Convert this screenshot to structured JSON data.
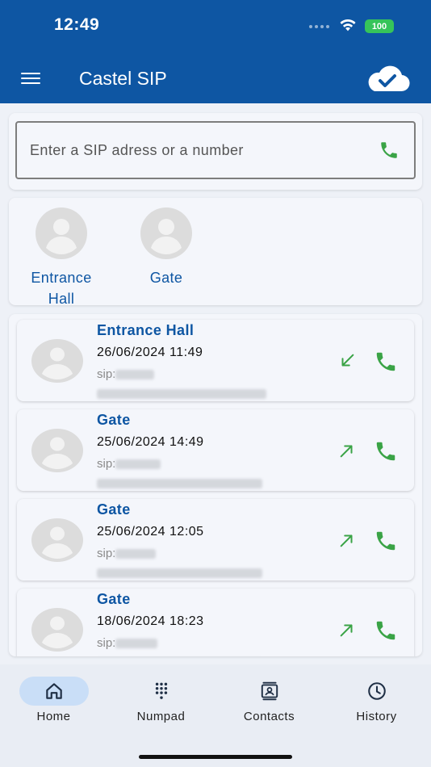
{
  "status_bar": {
    "time": "12:49",
    "battery": "100"
  },
  "app_bar": {
    "title": "Castel SIP",
    "menu_icon": "menu-icon",
    "status_icon": "cloud-check-icon"
  },
  "search": {
    "placeholder": "Enter a SIP adress or a number"
  },
  "favorites": [
    {
      "label": "Entrance Hall"
    },
    {
      "label": "Gate"
    }
  ],
  "history": [
    {
      "name": "Entrance Hall",
      "datetime": "26/06/2024 11:49",
      "sip_prefix": "sip:",
      "direction": "incoming"
    },
    {
      "name": "Gate",
      "datetime": "25/06/2024 14:49",
      "sip_prefix": "sip:",
      "direction": "outgoing"
    },
    {
      "name": "Gate",
      "datetime": "25/06/2024 12:05",
      "sip_prefix": "sip:",
      "direction": "outgoing"
    },
    {
      "name": "Gate",
      "datetime": "18/06/2024 18:23",
      "sip_prefix": "sip:",
      "direction": "outgoing"
    }
  ],
  "bottom_nav": [
    {
      "label": "Home",
      "icon": "home-icon",
      "active": true
    },
    {
      "label": "Numpad",
      "icon": "numpad-icon",
      "active": false
    },
    {
      "label": "Contacts",
      "icon": "contacts-icon",
      "active": false
    },
    {
      "label": "History",
      "icon": "clock-icon",
      "active": false
    }
  ],
  "colors": {
    "primary": "#0e56a3",
    "call_green": "#3aa346",
    "nav_active": "#c9def7"
  }
}
